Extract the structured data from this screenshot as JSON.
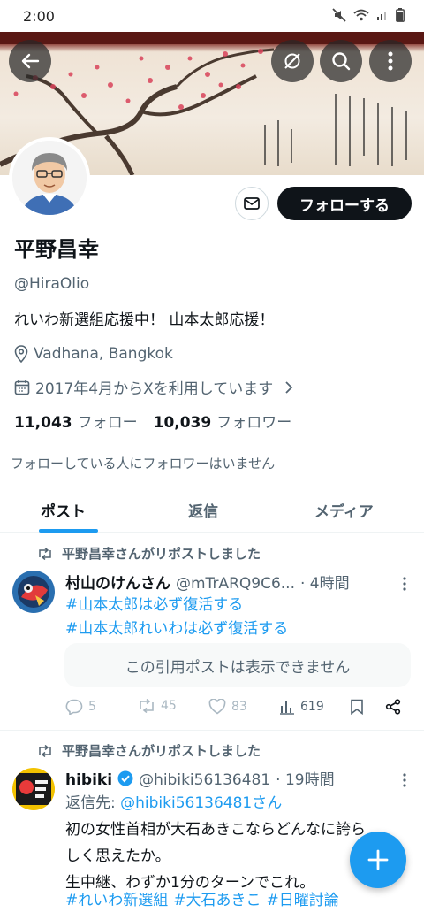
{
  "status_bar": {
    "time": "2:00"
  },
  "profile": {
    "name": "平野昌幸",
    "handle": "@HiraOlio",
    "bio": "れいわ新選組応援中！ 山本太郎応援！",
    "location": "Vadhana, Bangkok",
    "joined": "2017年4月からXを利用しています",
    "following_count": "11,043",
    "following_label": "フォロー",
    "followers_count": "10,039",
    "followers_label": "フォロワー",
    "no_mutual_followers": "フォローしている人にフォロワーはいません",
    "follow_button": "フォローする"
  },
  "tabs": [
    {
      "label": "ポスト",
      "active": true
    },
    {
      "label": "返信",
      "active": false
    },
    {
      "label": "メディア",
      "active": false
    }
  ],
  "posts": [
    {
      "repost_label": "平野昌幸さんがリポストしました",
      "author_name": "村山のけんさん",
      "author_handle": "@mTrARQ9C6...",
      "time": "· 4時間",
      "hashtags": [
        "#山本太郎は必ず復活する",
        "#山本太郎れいわは必ず復活する"
      ],
      "quote_unavailable": "この引用ポストは表示できません",
      "replies": "5",
      "reposts": "45",
      "likes": "83",
      "views": "619"
    },
    {
      "repost_label": "平野昌幸さんがリポストしました",
      "author_name": "hibiki",
      "author_handle": "@hibiki56136481",
      "time": "· 19時間",
      "reply_to_label": "返信先:",
      "reply_to_handle": "@hibiki56136481さん",
      "text_line1": "初の女性首相が大石あきこならどんなに誇ら",
      "text_line2": "しく思えたか。",
      "text_line3": "生中継、わずか1分のターンでこれ。",
      "hashtags": [
        "#れいわ新選組",
        "#大石あきこ",
        "#日曜討論"
      ]
    }
  ],
  "colors": {
    "accent": "#1d9bf0",
    "text": "#0f1419",
    "secondary": "#536471",
    "verified_badge": "#1d9bf0"
  }
}
